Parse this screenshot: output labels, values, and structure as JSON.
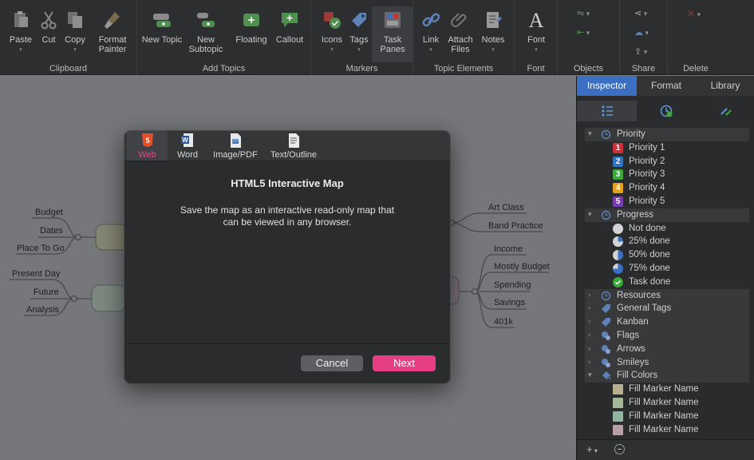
{
  "ribbon": {
    "groups": [
      {
        "label": "Clipboard",
        "buttons": [
          {
            "label": "Paste"
          },
          {
            "label": "Cut"
          },
          {
            "label": "Copy"
          },
          {
            "label": "Format Painter"
          }
        ]
      },
      {
        "label": "Add Topics",
        "buttons": [
          {
            "label": "New Topic"
          },
          {
            "label": "New Subtopic"
          },
          {
            "label": "Floating"
          },
          {
            "label": "Callout"
          }
        ]
      },
      {
        "label": "Markers",
        "buttons": [
          {
            "label": "Icons"
          },
          {
            "label": "Tags"
          },
          {
            "label": "Task Panes"
          }
        ]
      },
      {
        "label": "Topic Elements",
        "buttons": [
          {
            "label": "Link"
          },
          {
            "label": "Attach Files"
          },
          {
            "label": "Notes"
          }
        ]
      },
      {
        "label": "Font",
        "buttons": [
          {
            "label": "Font"
          }
        ]
      },
      {
        "label": "Objects"
      },
      {
        "label": "Share"
      },
      {
        "label": "Delete"
      }
    ]
  },
  "map": {
    "left_topics_1": [
      "Budget",
      "Dates",
      "Place To Go"
    ],
    "left_topics_2": [
      "Present Day",
      "Future",
      "Analysis"
    ],
    "right_topics_1": [
      "Art Class",
      "Band Practice"
    ],
    "right_topics_2": [
      "Income",
      "Mostly Budget",
      "Spending",
      "Savings",
      "401k"
    ]
  },
  "dialog": {
    "tabs": [
      {
        "label": "Web",
        "icon": "html5-icon"
      },
      {
        "label": "Word",
        "icon": "word-doc-icon"
      },
      {
        "label": "Image/PDF",
        "icon": "image-pdf-icon"
      },
      {
        "label": "Text/Outline",
        "icon": "text-outline-icon"
      }
    ],
    "title": "HTML5 Interactive Map",
    "description": "Save the map as an interactive read-only map that can be viewed in any browser.",
    "cancel_label": "Cancel",
    "next_label": "Next"
  },
  "panel": {
    "tabs": [
      "Inspector",
      "Format",
      "Library"
    ],
    "sections": {
      "priority": {
        "label": "Priority",
        "items": [
          "Priority 1",
          "Priority 2",
          "Priority 3",
          "Priority 4",
          "Priority 5"
        ]
      },
      "progress": {
        "label": "Progress",
        "items": [
          "Not done",
          "25% done",
          "50% done",
          "75% done",
          "Task done"
        ]
      },
      "resources": "Resources",
      "general_tags": "General Tags",
      "kanban": "Kanban",
      "flags": "Flags",
      "arrows": "Arrows",
      "smileys": "Smileys",
      "fill_colors": {
        "label": "Fill Colors",
        "items": [
          "Fill Marker Name",
          "Fill Marker Name",
          "Fill Marker Name",
          "Fill Marker Name"
        ]
      }
    }
  },
  "colors": {
    "accent": "#e53e85",
    "panel_tab_active": "#3a6fc3",
    "priority": [
      "#c8323a",
      "#2f74c0",
      "#3aa83a",
      "#e5a020",
      "#7a3db0"
    ],
    "fill": [
      "#b6b08e",
      "#a6b89a",
      "#8fb4a2",
      "#b8a0ab"
    ]
  }
}
